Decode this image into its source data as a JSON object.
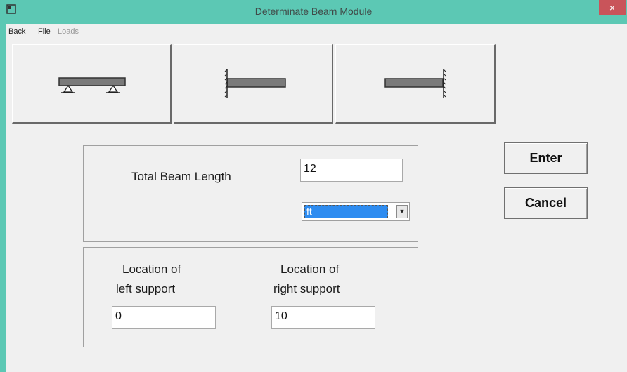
{
  "window": {
    "title": "Determinate Beam Module",
    "close_label": "×"
  },
  "menu": [
    {
      "label": "Back",
      "enabled": true
    },
    {
      "label": "File",
      "enabled": true
    },
    {
      "label": "Loads",
      "enabled": false
    }
  ],
  "toolbar": {
    "buttons": [
      {
        "icon": "simply-supported-beam-icon"
      },
      {
        "icon": "cantilever-left-fixed-icon"
      },
      {
        "icon": "cantilever-right-fixed-icon"
      }
    ]
  },
  "beam": {
    "length_label": "Total Beam Length",
    "length_value": "12",
    "unit_selected": "ft"
  },
  "supports": {
    "left_label_line1": "Location of",
    "left_label_line2": "left support",
    "left_value": "0",
    "right_label_line1": "Location of",
    "right_label_line2": "right support",
    "right_value": "10"
  },
  "actions": {
    "enter_label": "Enter",
    "cancel_label": "Cancel"
  },
  "colors": {
    "titlebar": "#5cc8b4",
    "close": "#c9545a",
    "selection": "#2e8cf0"
  }
}
